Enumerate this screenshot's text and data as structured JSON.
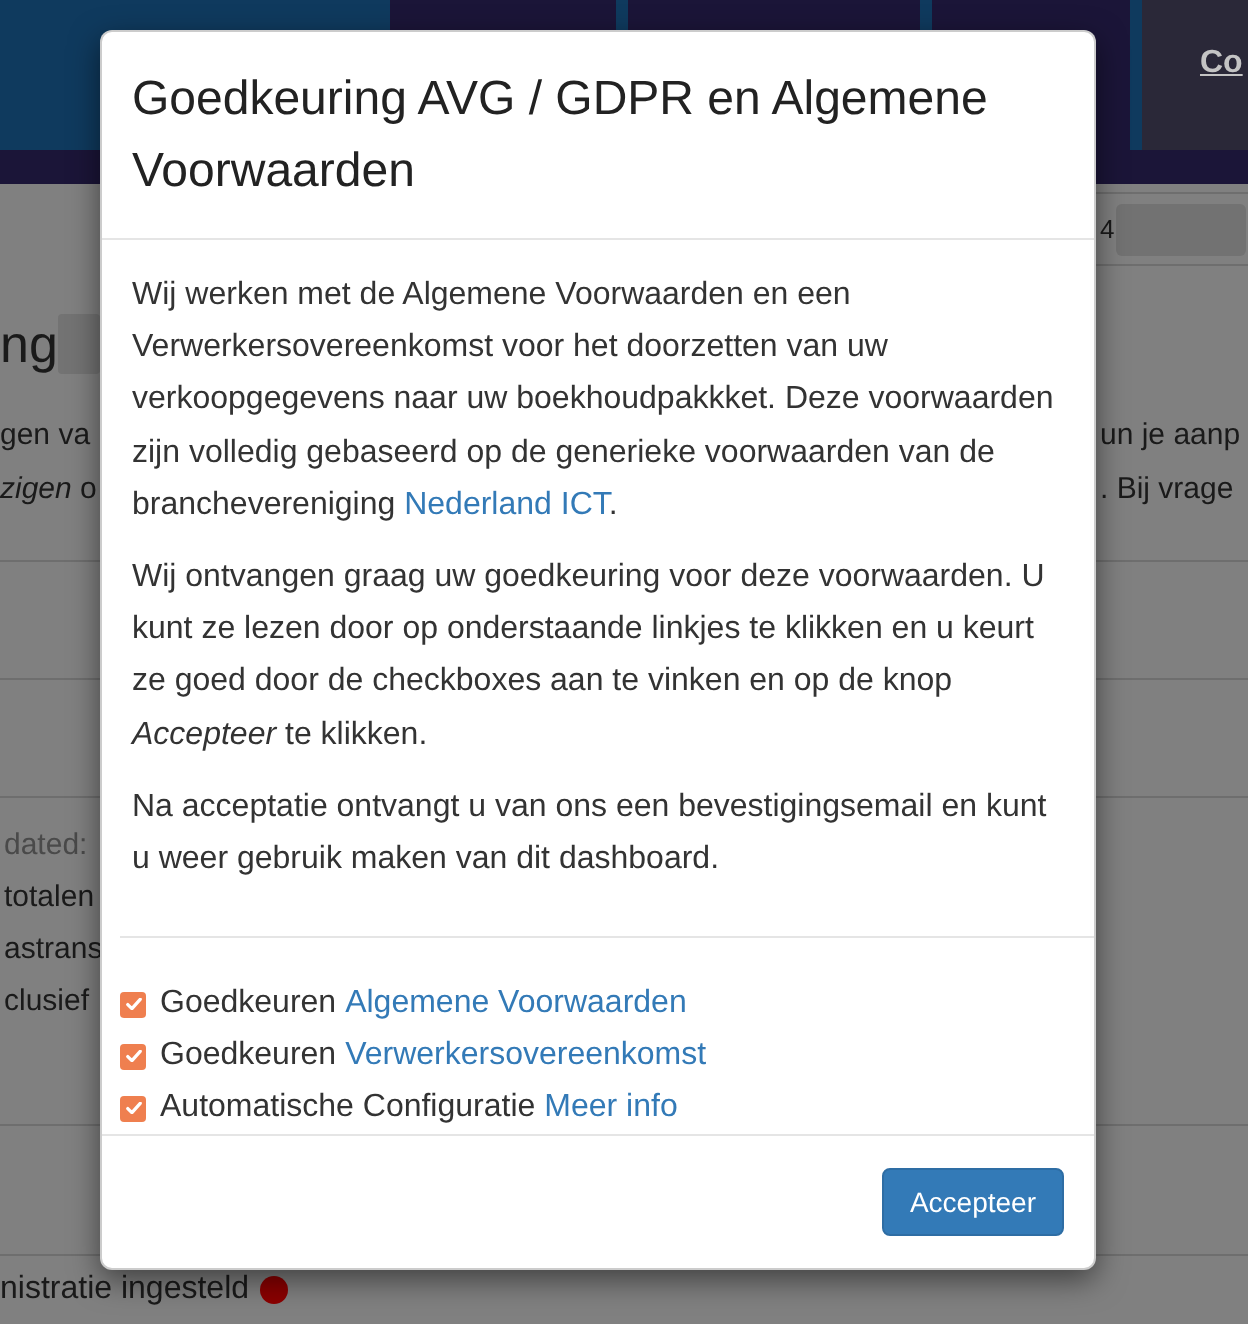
{
  "navbar": {
    "link": "Co"
  },
  "page": {
    "reference": "4",
    "heading": "ng",
    "intro": {
      "left": [
        "gen va",
        "*zigen* o"
      ],
      "right": [
        "un je aanp",
        ". Bij vrage"
      ]
    },
    "details": [
      {
        "kind": "muted",
        "text": "dated:"
      },
      {
        "kind": "plain",
        "text": "totalen"
      },
      {
        "kind": "plain",
        "text": "astrans"
      },
      {
        "kind": "plain",
        "text": "clusief"
      }
    ],
    "status": {
      "text": "nistratie ingesteld",
      "color": "#8b0000"
    }
  },
  "dialog": {
    "title": "Goedkeuring AVG / GDPR en Algemene Voorwaarden",
    "paragraphs": [
      [
        {
          "kind": "text",
          "text": "Wij werken met de Algemene Voorwaarden en een Verwerkersovereenkomst voor het doorzetten van uw verkoopgegevens naar uw boekhoudpakkket. Deze voorwaarden zijn volledig gebaseerd op de generieke voorwaarden van de branchevereniging "
        },
        {
          "kind": "link",
          "text": "Nederland ICT"
        },
        {
          "kind": "text",
          "text": "."
        }
      ],
      [
        {
          "kind": "text",
          "text": "Wij ontvangen graag uw goedkeuring voor deze voorwaarden. U kunt ze lezen door op onderstaande linkjes te klikken en u keurt ze goed door de checkboxes aan te vinken en op de knop *Accepteer* te klikken."
        }
      ],
      [
        {
          "kind": "text",
          "text": "Na acceptatie ontvangt u van ons een bevestigingsemail en kunt u weer gebruik maken van dit dashboard."
        }
      ]
    ],
    "consents": [
      {
        "label": "Goedkeuren",
        "link": "Algemene Voorwaarden",
        "checked": true
      },
      {
        "label": "Goedkeuren",
        "link": "Verwerkersovereenkomst",
        "checked": true
      },
      {
        "label": "Automatische Configuratie",
        "link": "Meer info",
        "checked": true
      }
    ],
    "button": "Accepteer"
  }
}
